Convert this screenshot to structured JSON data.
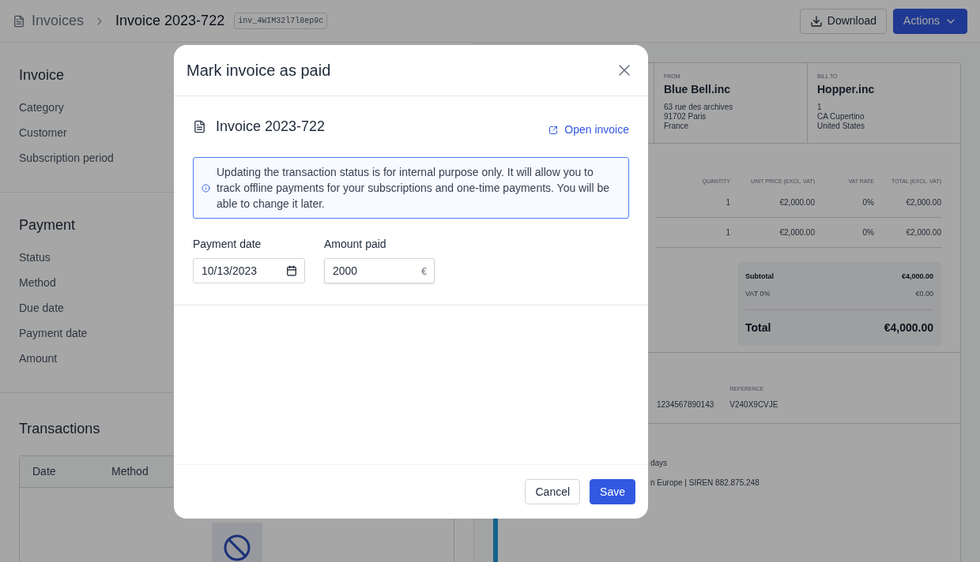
{
  "header": {
    "breadcrumb_parent": "Invoices",
    "title": "Invoice 2023-722",
    "id_badge": "inv_4WIM32l7l8ep9c",
    "buttons": [
      {
        "label": "Download",
        "kind": "secondary"
      },
      {
        "label": "Actions",
        "kind": "primary"
      }
    ]
  },
  "invoice_section": {
    "title": "Invoice",
    "fields": [
      "Category",
      "Customer",
      "Subscription period"
    ]
  },
  "payment_section": {
    "title": "Payment",
    "fields": [
      "Status",
      "Method",
      "Due date",
      "Payment date",
      "Amount"
    ]
  },
  "transactions": {
    "title": "Transactions",
    "columns": [
      "Date",
      "Method"
    ]
  },
  "preview": {
    "parties": [
      {
        "label": "FROM",
        "name": "Blue Bell.inc",
        "address": [
          "63 rue des archives",
          "91702 Paris",
          "France"
        ]
      },
      {
        "label": "BILL TO",
        "name": "Hopper.inc",
        "address": [
          "1",
          "CA Cupertino",
          "United States"
        ]
      }
    ],
    "line_items": {
      "columns": [
        "QUANTITY",
        "UNIT PRICE (EXCL. VAT)",
        "VAT RATE",
        "TOTAL (EXCL. VAT)"
      ],
      "rows": [
        [
          "1",
          "€2,000.00",
          "0%",
          "€2,000.00"
        ],
        [
          "1",
          "€2,000.00",
          "0%",
          "€2,000.00"
        ]
      ]
    },
    "totals": [
      {
        "label": "Subtotal",
        "value": "€4,000.00",
        "kind": "subtotal"
      },
      {
        "label": "VAT 0%",
        "value": "€0.00",
        "kind": "tax"
      },
      {
        "label": "Total",
        "value": "€4,000.00",
        "kind": "total"
      }
    ],
    "payment_info": {
      "column_1": "1234567890143",
      "reference_label": "REFERENCE",
      "reference": "V240X9CVJE"
    },
    "footer_lines": [
      "days",
      "n Europe | SIREN 882.875.248"
    ]
  },
  "modal": {
    "title": "Mark invoice as paid",
    "invoice_name": "Invoice 2023-722",
    "open_link": "Open invoice",
    "notice": "Updating the transaction status is for internal purpose only. It will allow you to track offline payments for your subscriptions and one-time payments. You will be able to change it later.",
    "fields": [
      {
        "kind": "date",
        "label": "Payment date",
        "value": "10/13/2023"
      },
      {
        "kind": "amount",
        "label": "Amount paid",
        "value": "2000",
        "suffix": "€"
      }
    ],
    "buttons": [
      {
        "label": "Cancel",
        "kind": "secondary"
      },
      {
        "label": "Save",
        "kind": "primary"
      }
    ]
  }
}
